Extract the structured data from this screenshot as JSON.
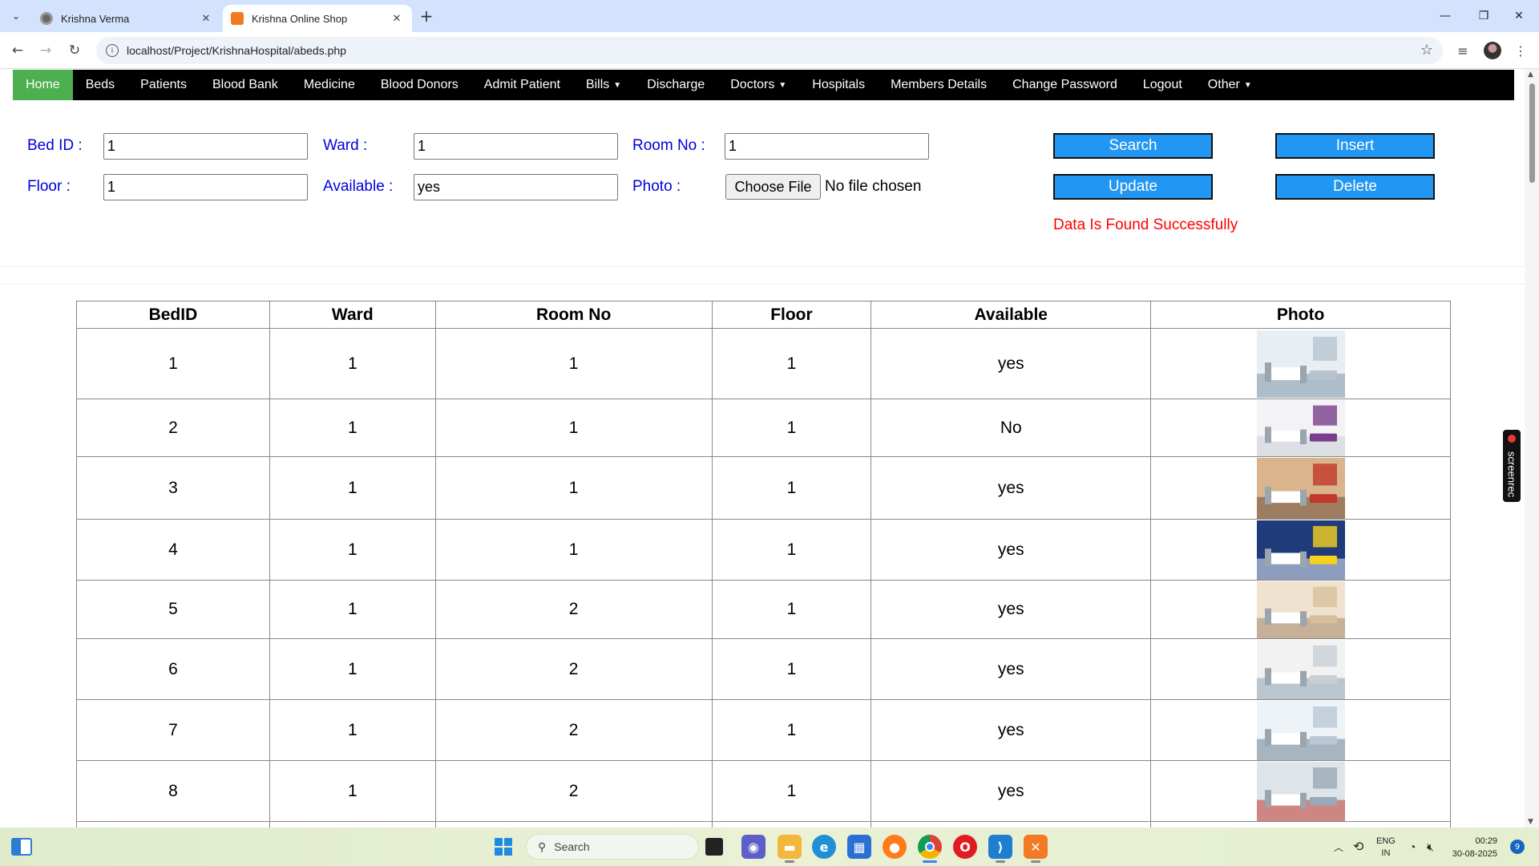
{
  "browser": {
    "tabs": [
      {
        "title": "Krishna Verma",
        "active": false
      },
      {
        "title": "Krishna Online Shop",
        "active": true
      }
    ],
    "url": "localhost/Project/KrishnaHospital/abeds.php"
  },
  "nav": {
    "items": [
      {
        "label": "Home",
        "active": true,
        "dropdown": false
      },
      {
        "label": "Beds",
        "active": false,
        "dropdown": false
      },
      {
        "label": "Patients",
        "active": false,
        "dropdown": false
      },
      {
        "label": "Blood Bank",
        "active": false,
        "dropdown": false
      },
      {
        "label": "Medicine",
        "active": false,
        "dropdown": false
      },
      {
        "label": "Blood Donors",
        "active": false,
        "dropdown": false
      },
      {
        "label": "Admit Patient",
        "active": false,
        "dropdown": false
      },
      {
        "label": "Bills",
        "active": false,
        "dropdown": true
      },
      {
        "label": "Discharge",
        "active": false,
        "dropdown": false
      },
      {
        "label": "Doctors",
        "active": false,
        "dropdown": true
      },
      {
        "label": "Hospitals",
        "active": false,
        "dropdown": false
      },
      {
        "label": "Members Details",
        "active": false,
        "dropdown": false
      },
      {
        "label": "Change Password",
        "active": false,
        "dropdown": false
      },
      {
        "label": "Logout",
        "active": false,
        "dropdown": false
      },
      {
        "label": "Other",
        "active": false,
        "dropdown": true
      }
    ]
  },
  "form": {
    "bed_id_label": "Bed ID :",
    "bed_id_value": "1",
    "ward_label": "Ward :",
    "ward_value": "1",
    "room_label": "Room No :",
    "room_value": "1",
    "floor_label": "Floor :",
    "floor_value": "1",
    "available_label": "Available :",
    "available_value": "yes",
    "photo_label": "Photo :",
    "choose_file_label": "Choose File",
    "no_file_text": "No file chosen",
    "search_label": "Search",
    "insert_label": "Insert",
    "update_label": "Update",
    "delete_label": "Delete",
    "message": "Data Is Found Successfully"
  },
  "table": {
    "headers": [
      "BedID",
      "Ward",
      "Room No",
      "Floor",
      "Available",
      "Photo"
    ],
    "rows": [
      {
        "bedid": "1",
        "ward": "1",
        "room": "1",
        "floor": "1",
        "available": "yes",
        "photo": "hospital-bed-photo"
      },
      {
        "bedid": "2",
        "ward": "1",
        "room": "1",
        "floor": "1",
        "available": "No",
        "photo": "hospital-bed-photo"
      },
      {
        "bedid": "3",
        "ward": "1",
        "room": "1",
        "floor": "1",
        "available": "yes",
        "photo": "hospital-bed-photo"
      },
      {
        "bedid": "4",
        "ward": "1",
        "room": "1",
        "floor": "1",
        "available": "yes",
        "photo": "hospital-bed-photo"
      },
      {
        "bedid": "5",
        "ward": "1",
        "room": "2",
        "floor": "1",
        "available": "yes",
        "photo": "hospital-bed-photo"
      },
      {
        "bedid": "6",
        "ward": "1",
        "room": "2",
        "floor": "1",
        "available": "yes",
        "photo": "hospital-bed-photo"
      },
      {
        "bedid": "7",
        "ward": "1",
        "room": "2",
        "floor": "1",
        "available": "yes",
        "photo": "hospital-bed-photo"
      },
      {
        "bedid": "8",
        "ward": "1",
        "room": "2",
        "floor": "1",
        "available": "yes",
        "photo": "hospital-bed-photo"
      }
    ]
  },
  "screenrec": "screenrec",
  "taskbar": {
    "search_placeholder": "Search",
    "lang_top": "ENG",
    "lang_bottom": "IN",
    "time": "00:29",
    "date": "30-08-2025",
    "notifications": "9"
  },
  "colors": {
    "nav_bg": "#000000",
    "nav_active": "#4caf50",
    "label_blue": "#0000dd",
    "button_blue": "#2196f3",
    "message_red": "#ff0000"
  }
}
